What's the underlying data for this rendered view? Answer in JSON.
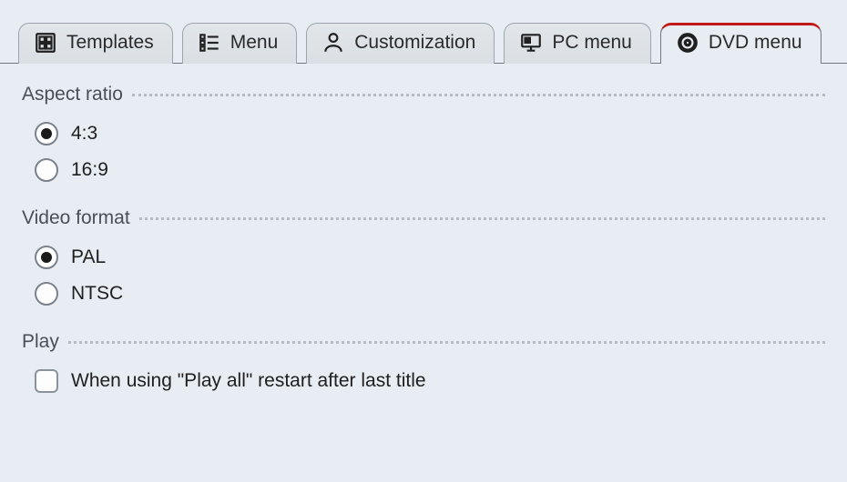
{
  "tabs": [
    {
      "id": "templates",
      "label": "Templates",
      "icon": "templates-icon",
      "active": false
    },
    {
      "id": "menu",
      "label": "Menu",
      "icon": "menu-icon",
      "active": false
    },
    {
      "id": "customization",
      "label": "Customization",
      "icon": "customization-icon",
      "active": false
    },
    {
      "id": "pc-menu",
      "label": "PC menu",
      "icon": "pc-menu-icon",
      "active": false
    },
    {
      "id": "dvd-menu",
      "label": "DVD menu",
      "icon": "dvd-menu-icon",
      "active": true
    }
  ],
  "groups": {
    "aspect_ratio": {
      "title": "Aspect ratio",
      "opt_4_3": {
        "label": "4:3",
        "selected": true
      },
      "opt_16_9": {
        "label": "16:9",
        "selected": false
      }
    },
    "video_format": {
      "title": "Video format",
      "opt_pal": {
        "label": "PAL",
        "selected": true
      },
      "opt_ntsc": {
        "label": "NTSC",
        "selected": false
      }
    },
    "play": {
      "title": "Play",
      "restart_after_last": {
        "label": "When using \"Play all\" restart after last title",
        "checked": false
      }
    }
  }
}
